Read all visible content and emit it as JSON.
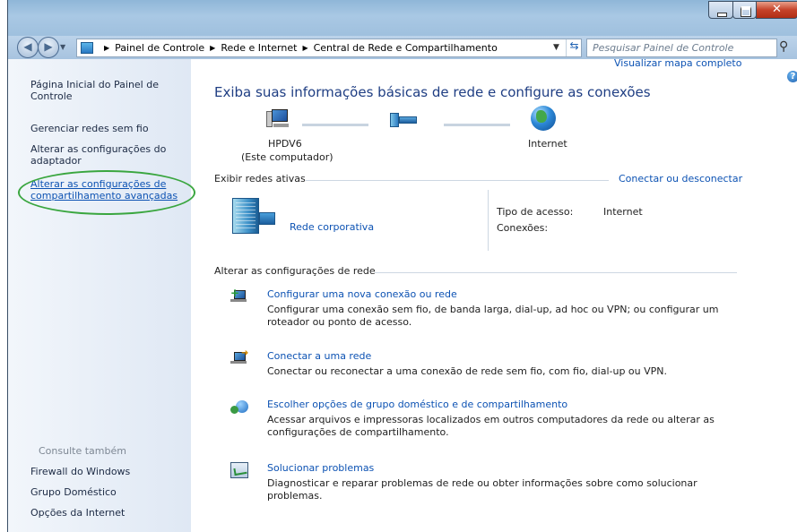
{
  "address_bar": {
    "crumbs": [
      "Painel de Controle",
      "Rede e Internet",
      "Central de Rede e Compartilhamento"
    ],
    "search_placeholder": "Pesquisar Painel de Controle"
  },
  "sidebar": {
    "home": "Página Inicial do Painel de Controle",
    "items": [
      "Gerenciar redes sem fio",
      "Alterar as configurações do adaptador",
      "Alterar as configurações de compartilhamento avançadas"
    ],
    "see_also_header": "Consulte também",
    "see_also": [
      "Firewall do Windows",
      "Grupo Doméstico",
      "Opções da Internet"
    ]
  },
  "main": {
    "title": "Exiba suas informações básicas de rede e configure as conexões",
    "map_link": "Visualizar mapa completo",
    "computer_name": "HPDV6",
    "computer_sub": "(Este computador)",
    "internet_label": "Internet",
    "active_networks_header": "Exibir redes ativas",
    "connect_link": "Conectar ou desconectar",
    "network_name": "Rede corporativa",
    "access_type_label": "Tipo de acesso:",
    "access_type_value": "Internet",
    "connections_label": "Conexões:",
    "change_settings_header": "Alterar as configurações de rede",
    "tasks": [
      {
        "title": "Configurar uma nova conexão ou rede",
        "desc": "Configurar uma conexão sem fio, de banda larga, dial-up, ad hoc ou VPN; ou configurar um roteador ou ponto de acesso."
      },
      {
        "title": "Conectar a uma rede",
        "desc": "Conectar ou reconectar a uma conexão de rede sem fio, com fio, dial-up ou VPN."
      },
      {
        "title": "Escolher opções de grupo doméstico e de compartilhamento",
        "desc": "Acessar arquivos e impressoras localizados em outros computadores da rede ou alterar as configurações de compartilhamento."
      },
      {
        "title": "Solucionar problemas",
        "desc": "Diagnosticar e reparar problemas de rede ou obter informações sobre como solucionar problemas."
      }
    ]
  },
  "icons": {
    "help": "help-icon",
    "search": "search-icon",
    "refresh": "refresh-icon",
    "highlight_color": "#3aa63f",
    "link_color": "#0c52b3"
  }
}
